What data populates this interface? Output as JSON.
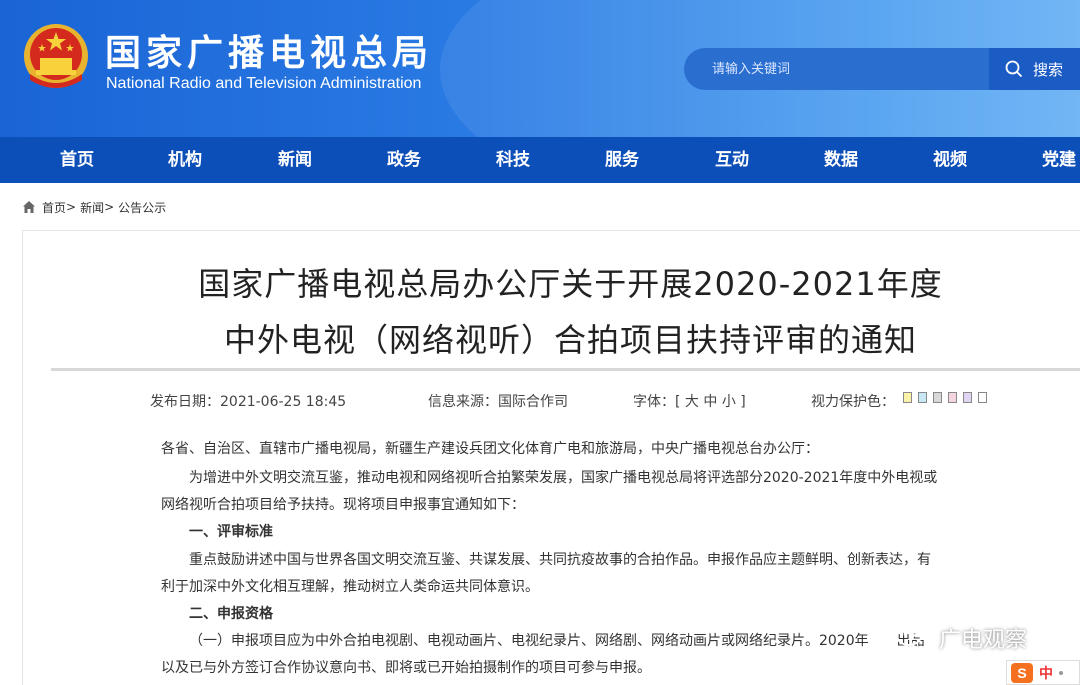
{
  "header": {
    "title": "国家广播电视总局",
    "subtitle": "National Radio and Television Administration",
    "search_placeholder": "请输入关键词",
    "search_button": "搜索"
  },
  "nav": {
    "items": [
      "首页",
      "机构",
      "新闻",
      "政务",
      "科技",
      "服务",
      "互动",
      "数据",
      "视频",
      "党建"
    ]
  },
  "breadcrumb": {
    "home": "首页",
    "news": "新闻",
    "section": "公告公示",
    "separator": ">"
  },
  "article": {
    "title_line1": "国家广播电视总局办公厅关于开展2020-2021年度",
    "title_line2": "中外电视（网络视听）合拍项目扶持评审的通知",
    "publish_date": "发布日期：2021-06-25 18:45",
    "source": "信息来源：国际合作司",
    "font_label": "字体：",
    "font_open": "[",
    "font_large": "大",
    "font_medium": "中",
    "font_small": "小",
    "font_close": "]",
    "eye_care_label": "视力保护色：",
    "eye_colors": [
      "#fbf1a9",
      "#c8e8f5",
      "#d8d8d8",
      "#f5d5e0",
      "#e2d5f3",
      "#ffffff"
    ],
    "paragraphs": [
      "各省、自治区、直辖市广播电视局，新疆生产建设兵团文化体育广电和旅游局，中央广播电视总台办公厅：",
      "为增进中外文明交流互鉴，推动电视和网络视听合拍繁荣发展，国家广播电视总局将评选部分2020-2021年度中外电视或",
      "网络视听合拍项目给予扶持。现将项目申报事宜通知如下：",
      "一、评审标准",
      "重点鼓励讲述中国与世界各国文明交流互鉴、共谋发展、共同抗疫故事的合拍作品。申报作品应主题鲜明、创新表达，有",
      "利于加深中外文化相互理解，推动树立人类命运共同体意识。",
      "二、申报资格",
      "（一）申报项目应为中外合拍电视剧、电视动画片、电视纪录片、网络剧、网络动画片或网络纪录片。2020年",
      "以及已与外方签订合作协议意向书、即将或已开始拍摄制作的项目可参与申报。"
    ],
    "paragraph2_tail": "出品"
  },
  "watermark": {
    "text": "广电观察"
  },
  "ime": {
    "logo": "S",
    "mode": "中"
  },
  "colors": {
    "header_blue": "#1a64d6",
    "nav_blue": "#0d4fb8"
  }
}
